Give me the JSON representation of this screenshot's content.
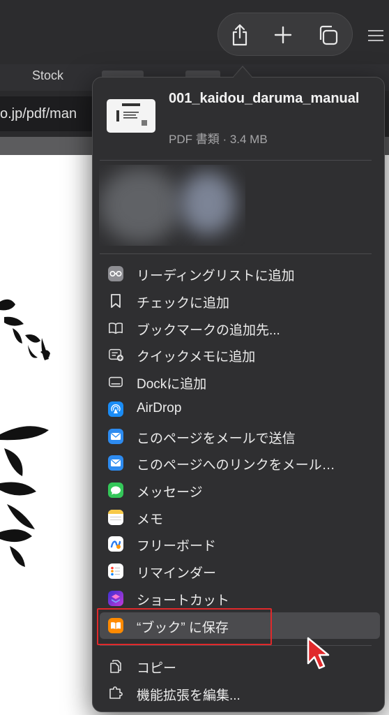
{
  "browser": {
    "tab_label": "Stock",
    "url_fragment": "o.jp/pdf/man"
  },
  "toolbar": {
    "share_icon": "share-icon",
    "new_tab_icon": "plus-icon",
    "tabs_overview_icon": "tabs-overview-icon"
  },
  "share": {
    "file_name": "001_kaidou_daruma_manual",
    "file_meta": "PDF 書類 · 3.4 MB",
    "items": [
      {
        "label": "リーディングリストに追加",
        "icon": "reading-list-icon"
      },
      {
        "label": "チェックに追加",
        "icon": "bookmark-icon"
      },
      {
        "label": "ブックマークの追加先...",
        "icon": "book-icon"
      },
      {
        "label": "クイックメモに追加",
        "icon": "quick-note-icon"
      },
      {
        "label": "Dockに追加",
        "icon": "dock-icon"
      },
      {
        "label": "AirDrop",
        "icon": "airdrop-icon"
      },
      {
        "label": "このページをメールで送信",
        "icon": "mail-icon"
      },
      {
        "label": "このページへのリンクをメール…",
        "icon": "mail-icon"
      },
      {
        "label": "メッセージ",
        "icon": "messages-icon"
      },
      {
        "label": "メモ",
        "icon": "notes-icon"
      },
      {
        "label": "フリーボード",
        "icon": "freeform-icon"
      },
      {
        "label": "リマインダー",
        "icon": "reminders-icon"
      },
      {
        "label": "ショートカット",
        "icon": "shortcuts-icon"
      },
      {
        "label": "“ブック” に保存",
        "icon": "books-icon"
      },
      {
        "label": "コピー",
        "icon": "copy-icon"
      },
      {
        "label": "機能拡張を編集...",
        "icon": "extensions-icon"
      }
    ]
  },
  "colors": {
    "highlight_box": "#e0292b",
    "cursor": "#e0292b"
  }
}
